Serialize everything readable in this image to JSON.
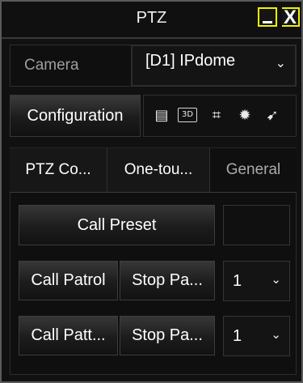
{
  "window": {
    "title": "PTZ"
  },
  "title_bar": {
    "minimize_icon": "minimize-icon",
    "close_icon": "close-icon",
    "close_glyph": "X"
  },
  "camera": {
    "label": "Camera",
    "selected_value": "[D1] IPdome",
    "arrow_glyph": "⌄"
  },
  "configuration": {
    "button_label": "Configuration",
    "icons": [
      {
        "name": "list-icon",
        "glyph": "▤"
      },
      {
        "name": "3d-icon",
        "glyph": "3D"
      },
      {
        "name": "zoom-frame-icon",
        "glyph": "⌗"
      },
      {
        "name": "light-icon",
        "glyph": "✹"
      },
      {
        "name": "wiper-icon",
        "glyph": "➹"
      }
    ]
  },
  "tabs": [
    {
      "label": "PTZ Co...",
      "active": true
    },
    {
      "label": "One-tou...",
      "active": false
    },
    {
      "label": "General",
      "active": false
    }
  ],
  "preset": {
    "call_button": "Call Preset",
    "number_value": ""
  },
  "patrol": {
    "call_button": "Call Patrol",
    "stop_button": "Stop Pa...",
    "selected_value": "1",
    "arrow_glyph": "⌄"
  },
  "pattern": {
    "call_button": "Call Patt...",
    "stop_button": "Stop Pa...",
    "selected_value": "1",
    "arrow_glyph": "⌄"
  },
  "colors": {
    "title_button_border": "#f2f000",
    "background": "#111111",
    "text": "#ffffff",
    "muted_text": "#9e9e9e"
  }
}
